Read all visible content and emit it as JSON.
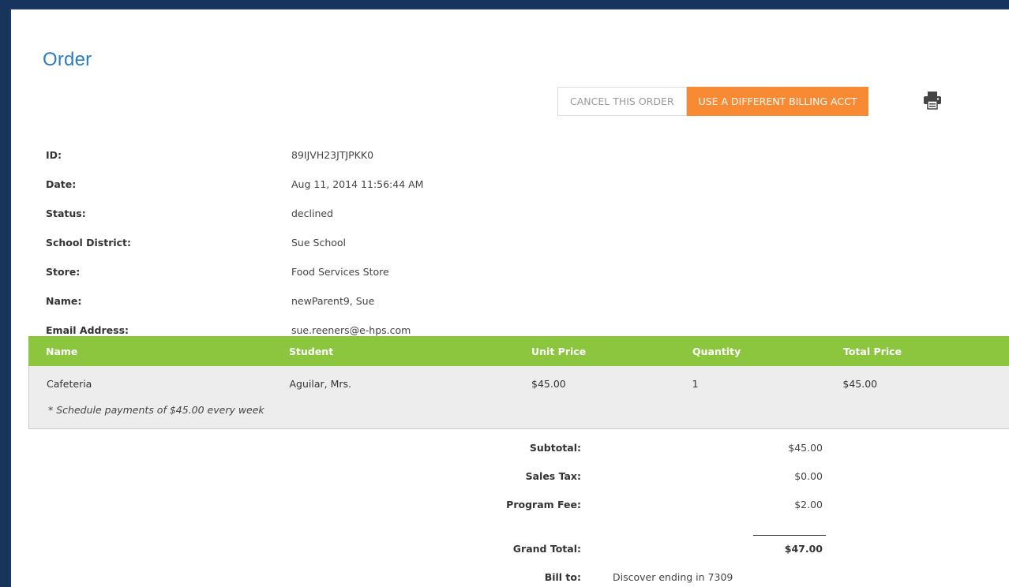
{
  "page": {
    "title": "Order"
  },
  "toolbar": {
    "cancel_label": "CANCEL THIS ORDER",
    "billing_label": "USE A DIFFERENT BILLING ACCT",
    "print_icon": "printer-icon"
  },
  "order_info": [
    {
      "label": "ID:",
      "value": "89IJVH23JTJPKK0"
    },
    {
      "label": "Date:",
      "value": "Aug 11, 2014 11:56:44 AM"
    },
    {
      "label": "Status:",
      "value": "declined"
    },
    {
      "label": "School District:",
      "value": "Sue School"
    },
    {
      "label": "Store:",
      "value": "Food Services Store"
    },
    {
      "label": "Name:",
      "value": "newParent9, Sue"
    },
    {
      "label": "Email Address:",
      "value": "sue.reeners@e-hps.com"
    }
  ],
  "table": {
    "headers": {
      "name": "Name",
      "student": "Student",
      "unit_price": "Unit Price",
      "quantity": "Quantity",
      "total_price": "Total Price"
    },
    "rows": [
      {
        "name": "Cafeteria",
        "student": "Aguilar, Mrs.",
        "unit_price": "$45.00",
        "quantity": "1",
        "total_price": "$45.00",
        "note": "* Schedule payments of $45.00 every week"
      }
    ]
  },
  "totals": {
    "subtotal_label": "Subtotal:",
    "subtotal_value": "$45.00",
    "sales_tax_label": "Sales Tax:",
    "sales_tax_value": "$0.00",
    "program_fee_label": "Program Fee:",
    "program_fee_value": "$2.00",
    "grand_total_label": "Grand Total:",
    "grand_total_value": "$47.00",
    "bill_to_label": "Bill to:",
    "bill_to_value": "Discover ending in 7309"
  },
  "colors": {
    "title": "#2d7cc1",
    "accent_orange": "#f78a33",
    "header_green": "#8cc63f",
    "frame_border": "#1b3b66"
  }
}
